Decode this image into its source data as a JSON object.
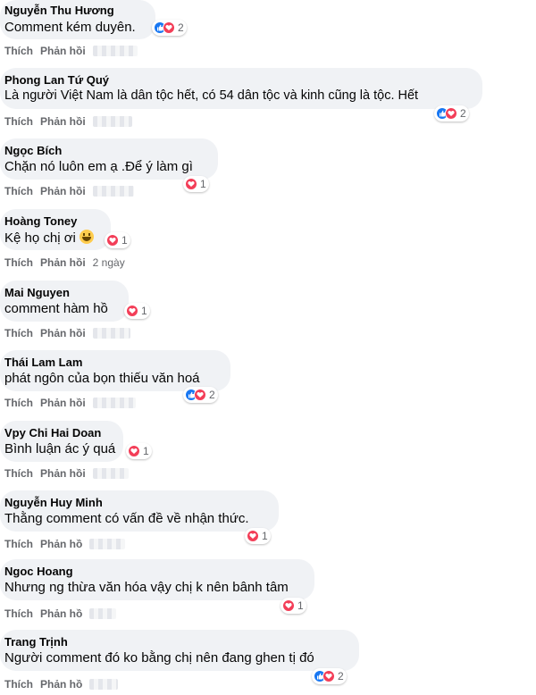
{
  "labels": {
    "like": "Thích",
    "reply": "Phản hồi"
  },
  "reaction_colors": {
    "like": "#1877f2",
    "love": "#f33e58"
  },
  "comments": [
    {
      "name": "Nguyễn Thu Hương",
      "text": "Comment kém duyên.",
      "reactions": [
        "like-icon",
        "love-icon"
      ],
      "count": "2",
      "reply": "Phản hồi"
    },
    {
      "name": "Phong Lan Tứ Quý",
      "text": "Là người Việt Nam là dân tộc hết, có 54 dân tộc và kinh cũng là tộc. Hết",
      "reactions": [
        "like-icon",
        "love-icon"
      ],
      "count": "2",
      "reply": "Phản hồi"
    },
    {
      "name": "Ngọc Bích",
      "text": "Chặn nó luôn em ạ .Để ý làm gì",
      "reactions": [
        "love-icon"
      ],
      "count": "1",
      "reply": "Phản hồi"
    },
    {
      "name": "Hoàng Toney",
      "text": "Kệ họ chị ơi",
      "reactions": [
        "love-icon"
      ],
      "count": "1",
      "reply": "Phản hồi",
      "time": "2 ngày"
    },
    {
      "name": "Mai Nguyen",
      "text": "comment hàm hồ",
      "reactions": [
        "love-icon"
      ],
      "count": "1",
      "reply": "Phản hồi"
    },
    {
      "name": "Thái Lam Lam",
      "text": "phát ngôn của bọn thiếu văn hoá",
      "reactions": [
        "like-icon",
        "love-icon"
      ],
      "count": "2",
      "reply": "Phản hồi"
    },
    {
      "name": "Vpy Chi Hai Doan",
      "text": "Bình luận ác ý quá",
      "reactions": [
        "love-icon"
      ],
      "count": "1",
      "reply": "Phản hồi"
    },
    {
      "name": "Nguyễn Huy Minh",
      "text": "Thằng comment có vấn đề về nhận thức.",
      "reactions": [
        "love-icon"
      ],
      "count": "1",
      "reply": "Phản hồ"
    },
    {
      "name": "Ngoc Hoang",
      "text": "Nhưng ng thừa văn hóa vậy chị k nên bânh tâm",
      "reactions": [
        "love-icon"
      ],
      "count": "1",
      "reply": "Phản hồ"
    },
    {
      "name": "Trang Trịnh",
      "text": "Người comment đó ko bằng chị nên đang ghen tị đó",
      "reactions": [
        "like-icon",
        "love-icon"
      ],
      "count": "2",
      "reply": "Phản hồ"
    }
  ]
}
